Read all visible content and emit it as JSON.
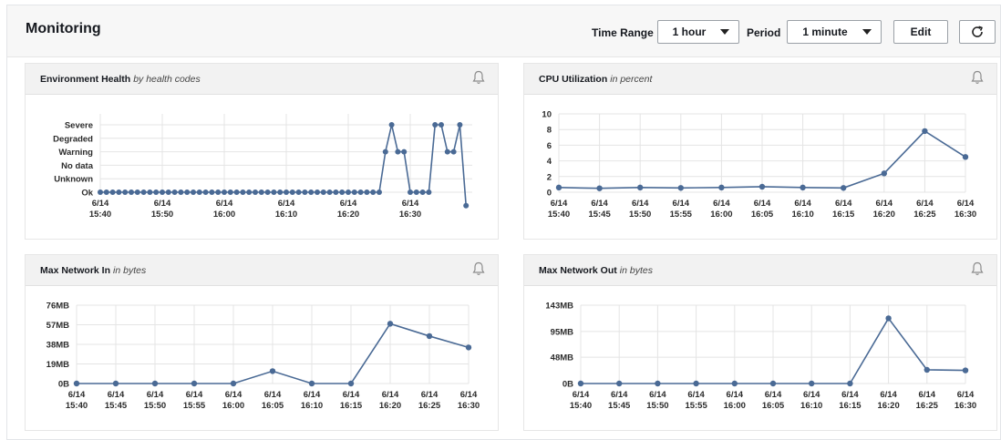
{
  "header": {
    "title": "Monitoring",
    "time_range_label": "Time Range",
    "time_range_value": "1 hour",
    "period_label": "Period",
    "period_value": "1 minute",
    "edit_label": "Edit"
  },
  "panels": [
    {
      "title": "Environment Health",
      "subtitle": "by health codes",
      "chart_data": {
        "type": "line",
        "y_categories": [
          "Ok",
          "Unknown",
          "No data",
          "Warning",
          "Degraded",
          "Severe"
        ],
        "x_ticks": [
          [
            "6/14",
            "15:40"
          ],
          [
            "6/14",
            "15:50"
          ],
          [
            "6/14",
            "16:00"
          ],
          [
            "6/14",
            "16:10"
          ],
          [
            "6/14",
            "16:20"
          ],
          [
            "6/14",
            "16:30"
          ]
        ],
        "x_tick_minutes": [
          0,
          10,
          20,
          30,
          40,
          50
        ],
        "x_range": [
          0,
          60
        ],
        "series": [
          {
            "color": "#4a6a95",
            "x": [
              0,
              1,
              2,
              3,
              4,
              5,
              6,
              7,
              8,
              9,
              10,
              11,
              12,
              13,
              14,
              15,
              16,
              17,
              18,
              19,
              20,
              21,
              22,
              23,
              24,
              25,
              26,
              27,
              28,
              29,
              30,
              31,
              32,
              33,
              34,
              35,
              36,
              37,
              38,
              39,
              40,
              41,
              42,
              43,
              44,
              45,
              46,
              47,
              48,
              49,
              50,
              51,
              52,
              53,
              54,
              55,
              56,
              57,
              58,
              59
            ],
            "y": [
              "Ok",
              "Ok",
              "Ok",
              "Ok",
              "Ok",
              "Ok",
              "Ok",
              "Ok",
              "Ok",
              "Ok",
              "Ok",
              "Ok",
              "Ok",
              "Ok",
              "Ok",
              "Ok",
              "Ok",
              "Ok",
              "Ok",
              "Ok",
              "Ok",
              "Ok",
              "Ok",
              "Ok",
              "Ok",
              "Ok",
              "Ok",
              "Ok",
              "Ok",
              "Ok",
              "Ok",
              "Ok",
              "Ok",
              "Ok",
              "Ok",
              "Ok",
              "Ok",
              "Ok",
              "Ok",
              "Ok",
              "Ok",
              "Ok",
              "Ok",
              "Ok",
              "Ok",
              "Ok",
              "Warning",
              "Severe",
              "Warning",
              "Warning",
              "Ok",
              "Ok",
              "Ok",
              "Ok",
              "Severe",
              "Severe",
              "Warning",
              "Warning",
              "Severe"
            ]
          }
        ],
        "grid": true
      }
    },
    {
      "title": "CPU Utilization",
      "subtitle": "in percent",
      "chart_data": {
        "type": "line",
        "y_ticks": [
          "0",
          "2",
          "4",
          "6",
          "8",
          "10"
        ],
        "ylim": [
          0,
          10
        ],
        "x_ticks": [
          [
            "6/14",
            "15:40"
          ],
          [
            "6/14",
            "15:45"
          ],
          [
            "6/14",
            "15:50"
          ],
          [
            "6/14",
            "15:55"
          ],
          [
            "6/14",
            "16:00"
          ],
          [
            "6/14",
            "16:05"
          ],
          [
            "6/14",
            "16:10"
          ],
          [
            "6/14",
            "16:15"
          ],
          [
            "6/14",
            "16:20"
          ],
          [
            "6/14",
            "16:25"
          ],
          [
            "6/14",
            "16:30"
          ]
        ],
        "x_range": [
          0,
          10
        ],
        "series": [
          {
            "color": "#4a6a95",
            "x": [
              0,
              1,
              2,
              3,
              4,
              5,
              6,
              7,
              8,
              9,
              10
            ],
            "y": [
              0.6,
              0.5,
              0.6,
              0.55,
              0.6,
              0.7,
              0.6,
              0.55,
              2.4,
              7.8,
              4.5
            ]
          }
        ],
        "grid": true
      }
    },
    {
      "title": "Max Network In",
      "subtitle": "in bytes",
      "chart_data": {
        "type": "line",
        "y_ticks": [
          "0B",
          "19MB",
          "38MB",
          "57MB",
          "76MB"
        ],
        "y_tick_values": [
          0,
          19,
          38,
          57,
          76
        ],
        "ylim": [
          0,
          76
        ],
        "x_ticks": [
          [
            "6/14",
            "15:40"
          ],
          [
            "6/14",
            "15:45"
          ],
          [
            "6/14",
            "15:50"
          ],
          [
            "6/14",
            "15:55"
          ],
          [
            "6/14",
            "16:00"
          ],
          [
            "6/14",
            "16:05"
          ],
          [
            "6/14",
            "16:10"
          ],
          [
            "6/14",
            "16:15"
          ],
          [
            "6/14",
            "16:20"
          ],
          [
            "6/14",
            "16:25"
          ],
          [
            "6/14",
            "16:30"
          ]
        ],
        "x_range": [
          0,
          10
        ],
        "series": [
          {
            "color": "#4a6a95",
            "x": [
              0,
              1,
              2,
              3,
              4,
              5,
              6,
              7,
              8,
              9,
              10
            ],
            "y": [
              0,
              0,
              0,
              0,
              0,
              12,
              0,
              0,
              58,
              46,
              35
            ]
          }
        ],
        "grid": true
      }
    },
    {
      "title": "Max Network Out",
      "subtitle": "in bytes",
      "chart_data": {
        "type": "line",
        "y_ticks": [
          "0B",
          "48MB",
          "95MB",
          "143MB"
        ],
        "y_tick_values": [
          0,
          48,
          95,
          143
        ],
        "ylim": [
          0,
          143
        ],
        "x_ticks": [
          [
            "6/14",
            "15:40"
          ],
          [
            "6/14",
            "15:45"
          ],
          [
            "6/14",
            "15:50"
          ],
          [
            "6/14",
            "15:55"
          ],
          [
            "6/14",
            "16:00"
          ],
          [
            "6/14",
            "16:05"
          ],
          [
            "6/14",
            "16:10"
          ],
          [
            "6/14",
            "16:15"
          ],
          [
            "6/14",
            "16:20"
          ],
          [
            "6/14",
            "16:25"
          ],
          [
            "6/14",
            "16:30"
          ]
        ],
        "x_range": [
          0,
          10
        ],
        "series": [
          {
            "color": "#4a6a95",
            "x": [
              0,
              1,
              2,
              3,
              4,
              5,
              6,
              7,
              8,
              9,
              10
            ],
            "y": [
              0,
              0,
              0,
              0,
              0,
              0,
              0,
              0,
              119,
              25,
              24
            ]
          }
        ],
        "grid": true
      }
    }
  ],
  "icons": {
    "refresh": "refresh-icon",
    "alarm": "bell-icon",
    "dropdown": "caret-down-icon"
  },
  "colors": {
    "series_line": "#4a6a95",
    "grid": "#e4e4e4",
    "panel_header_bg": "#f2f2f2"
  }
}
